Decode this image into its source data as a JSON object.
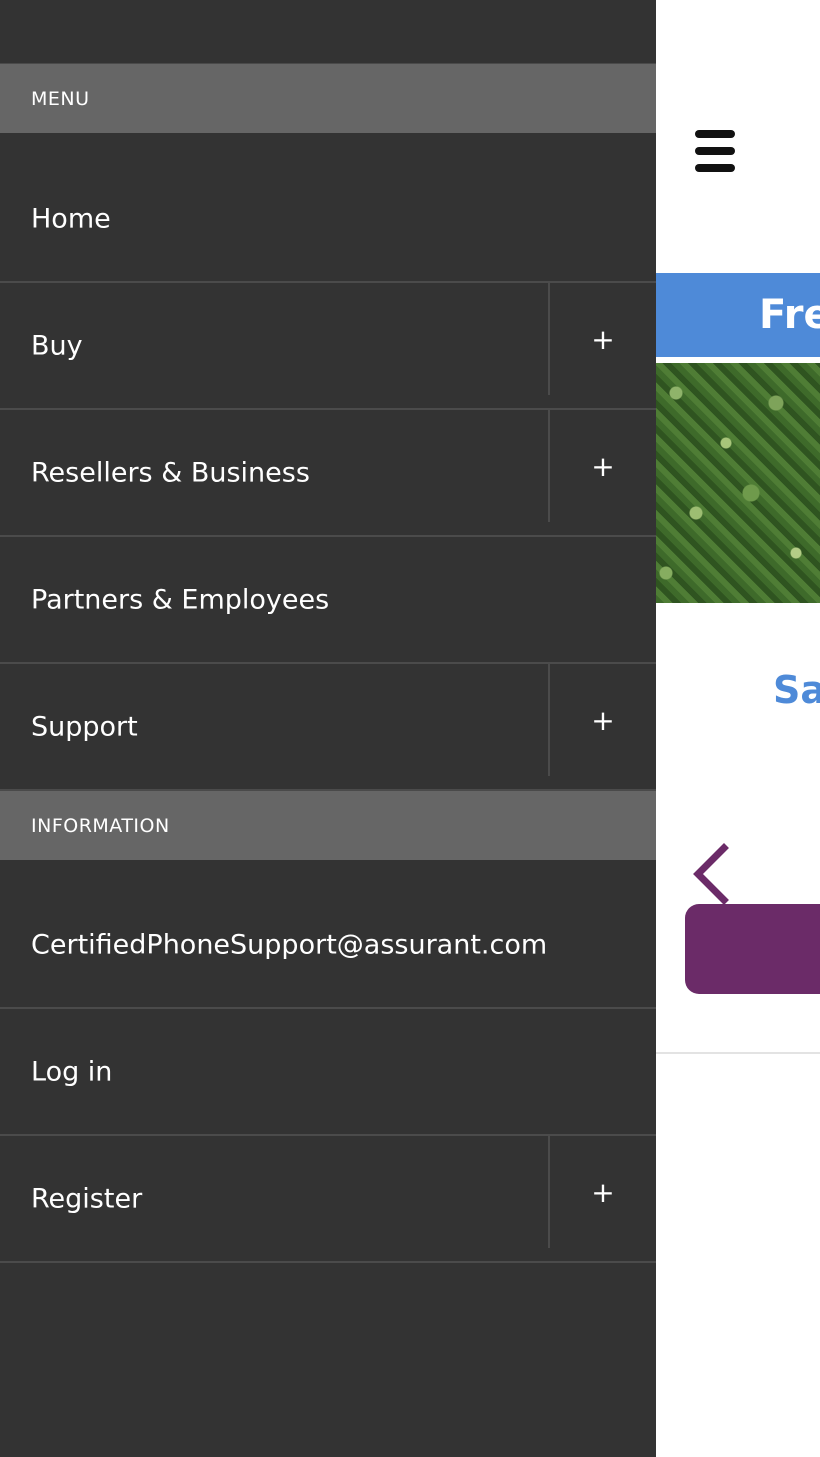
{
  "drawer": {
    "menu_header": "MENU",
    "menu_items": [
      {
        "label": "Home",
        "expandable": false
      },
      {
        "label": "Buy",
        "expandable": true,
        "expand_symbol": "+"
      },
      {
        "label": "Resellers & Business",
        "expandable": true,
        "expand_symbol": "+"
      },
      {
        "label": "Partners & Employees",
        "expandable": false
      },
      {
        "label": "Support",
        "expandable": true,
        "expand_symbol": "+"
      }
    ],
    "info_header": "INFORMATION",
    "info_items": [
      {
        "label": "CertifiedPhoneSupport@assurant.com",
        "expandable": false
      },
      {
        "label": "Log in",
        "expandable": false
      },
      {
        "label": "Register",
        "expandable": true,
        "expand_symbol": "+"
      }
    ]
  },
  "page": {
    "hamburger_icon": "hamburger-menu-icon",
    "banner_text": "Fre",
    "say_text": "Say",
    "prev_icon": "chevron-left-icon"
  },
  "colors": {
    "drawer_bg": "#333333",
    "section_header_bg": "#666666",
    "banner_blue": "#4e8ad8",
    "accent_purple": "#6b2b68"
  }
}
